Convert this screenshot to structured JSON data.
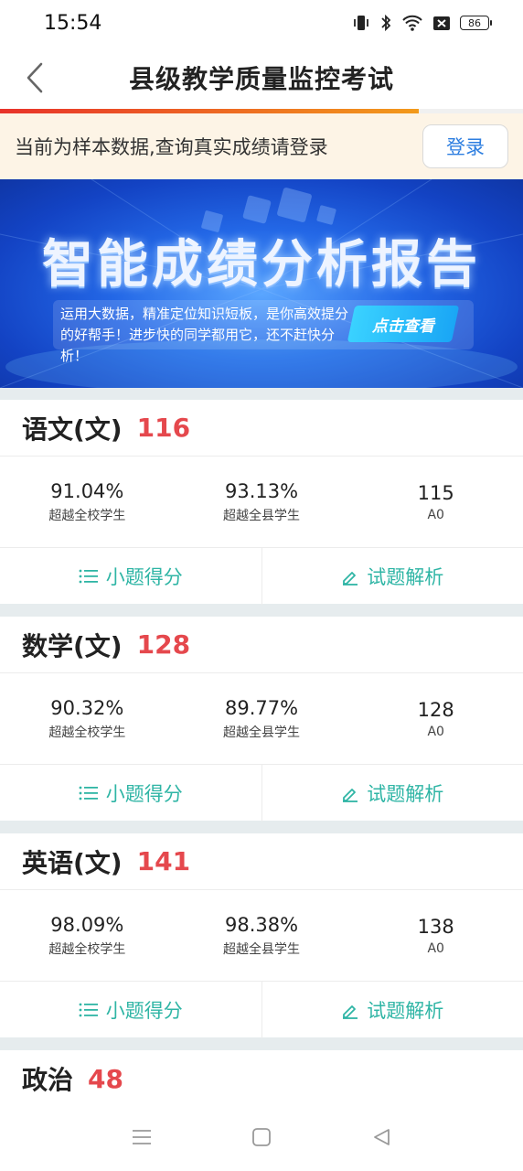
{
  "status_bar": {
    "time": "15:54",
    "battery": "86"
  },
  "nav": {
    "title": "县级教学质量监控考试"
  },
  "progress": {
    "fraction": 0.8
  },
  "notice": {
    "text": "当前为样本数据,查询真实成绩请登录",
    "login_label": "登录"
  },
  "banner": {
    "title": "智能成绩分析报告",
    "description": "运用大数据，精准定位知识短板，是你高效提分的好帮手！进步快的同学都用它，还不赶快分析！",
    "cta": "点击查看"
  },
  "subjects": [
    {
      "name": "语文(文)",
      "score": "116",
      "school_pct": "91.04%",
      "school_label": "超越全校学生",
      "county_pct": "93.13%",
      "county_label": "超越全县学生",
      "value": "115",
      "grade": "A0",
      "action_scores": "小题得分",
      "action_analysis": "试题解析"
    },
    {
      "name": "数学(文)",
      "score": "128",
      "school_pct": "90.32%",
      "school_label": "超越全校学生",
      "county_pct": "89.77%",
      "county_label": "超越全县学生",
      "value": "128",
      "grade": "A0",
      "action_scores": "小题得分",
      "action_analysis": "试题解析"
    },
    {
      "name": "英语(文)",
      "score": "141",
      "school_pct": "98.09%",
      "school_label": "超越全校学生",
      "county_pct": "98.38%",
      "county_label": "超越全县学生",
      "value": "138",
      "grade": "A0",
      "action_scores": "小题得分",
      "action_analysis": "试题解析"
    },
    {
      "name": "政治",
      "score": "48"
    }
  ],
  "colors": {
    "accent": "#2fb5a5",
    "score": "#e5484d",
    "link": "#2d7ee0"
  }
}
